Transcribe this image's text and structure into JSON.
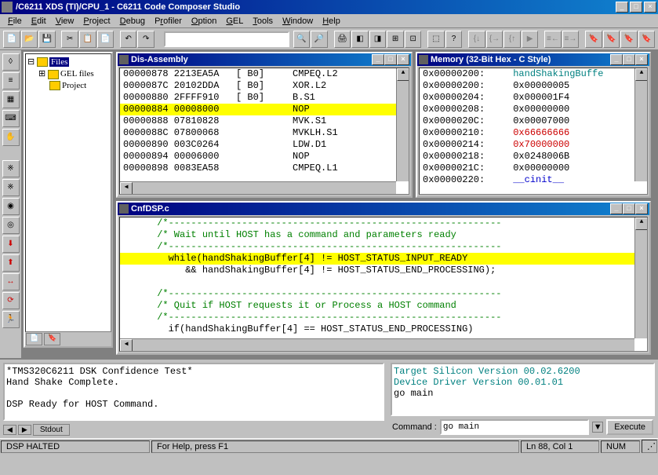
{
  "title": "/C6211 XDS (TI)/CPU_1 - C6211 Code Composer Studio",
  "menu": [
    "File",
    "Edit",
    "View",
    "Project",
    "Debug",
    "Profiler",
    "Option",
    "GEL",
    "Tools",
    "Window",
    "Help"
  ],
  "filetree": {
    "root": "Files",
    "child1": "GEL files",
    "child2": "Project"
  },
  "disasm": {
    "title": "Dis-Assembly",
    "rows": [
      {
        "addr": "00000878",
        "op": "2213EA5A",
        "col3": "[ B0]",
        "mnem": "CMPEQ.L2",
        "hl": false
      },
      {
        "addr": "0000087C",
        "op": "20102DDA",
        "col3": "[ B0]",
        "mnem": "XOR.L2",
        "hl": false
      },
      {
        "addr": "00000880",
        "op": "2FFFF910",
        "col3": "[ B0]",
        "mnem": "B.S1",
        "hl": false
      },
      {
        "addr": "00000884",
        "op": "00008000",
        "col3": "",
        "mnem": "NOP",
        "hl": true
      },
      {
        "addr": "00000888",
        "op": "07810828",
        "col3": "",
        "mnem": "MVK.S1",
        "hl": false
      },
      {
        "addr": "0000088C",
        "op": "07800068",
        "col3": "",
        "mnem": "MVKLH.S1",
        "hl": false
      },
      {
        "addr": "00000890",
        "op": "003C0264",
        "col3": "",
        "mnem": "LDW.D1",
        "hl": false
      },
      {
        "addr": "00000894",
        "op": "00006000",
        "col3": "",
        "mnem": "NOP",
        "hl": false
      },
      {
        "addr": "00000898",
        "op": "0083EA58",
        "col3": "",
        "mnem": "CMPEQ.L1",
        "hl": false
      }
    ]
  },
  "memory": {
    "title": "Memory (32-Bit Hex - C Style)",
    "rows": [
      {
        "a": "0x00000200:",
        "v": "handShakingBuffe",
        "cls": "mem-teal"
      },
      {
        "a": "0x00000200:",
        "v": "0x00000005",
        "cls": ""
      },
      {
        "a": "0x00000204:",
        "v": "0x000001F4",
        "cls": ""
      },
      {
        "a": "0x00000208:",
        "v": "0x00000000",
        "cls": ""
      },
      {
        "a": "0x0000020C:",
        "v": "0x00007000",
        "cls": ""
      },
      {
        "a": "0x00000210:",
        "v": "0x66666666",
        "cls": "mem-red"
      },
      {
        "a": "0x00000214:",
        "v": "0x70000000",
        "cls": "mem-red"
      },
      {
        "a": "0x00000218:",
        "v": "0x0248006B",
        "cls": ""
      },
      {
        "a": "0x0000021C:",
        "v": "0x00000000",
        "cls": ""
      },
      {
        "a": "0x00000220:",
        "v": "__cinit__",
        "cls": "mem-blue"
      }
    ]
  },
  "source": {
    "title": "CnfDSP.c",
    "lines": [
      {
        "t": "      /*-----------------------------------------------------------",
        "cls": "src-cmt"
      },
      {
        "t": "      /* Wait until HOST has a command and parameters ready",
        "cls": "src-cmt"
      },
      {
        "t": "      /*-----------------------------------------------------------",
        "cls": "src-cmt"
      },
      {
        "t": "        while(handShakingBuffer[4] != HOST_STATUS_INPUT_READY",
        "cls": "src-hl"
      },
      {
        "t": "           && handShakingBuffer[4] != HOST_STATUS_END_PROCESSING);",
        "cls": ""
      },
      {
        "t": "",
        "cls": ""
      },
      {
        "t": "      /*-----------------------------------------------------------",
        "cls": "src-cmt"
      },
      {
        "t": "      /* Quit if HOST requests it or Process a HOST command",
        "cls": "src-cmt"
      },
      {
        "t": "      /*-----------------------------------------------------------",
        "cls": "src-cmt"
      },
      {
        "t": "        if(handShakingBuffer[4] == HOST_STATUS_END_PROCESSING)",
        "cls": ""
      }
    ]
  },
  "output": {
    "lines": [
      "*TMS320C6211 DSK Confidence Test*",
      "Hand Shake Complete.",
      "",
      "DSP Ready for HOST Command."
    ],
    "tab": "Stdout"
  },
  "debugout": {
    "lines": [
      "    Target Silicon Version 00.02.6200",
      "     Device Driver Version 00.01.01",
      "go main"
    ],
    "cmd_label": "Command :",
    "cmd_value": "go main",
    "exec": "Execute"
  },
  "status": {
    "left": "DSP HALTED",
    "help": "For Help, press F1",
    "pos": "Ln 88, Col 1",
    "num": "NUM"
  }
}
